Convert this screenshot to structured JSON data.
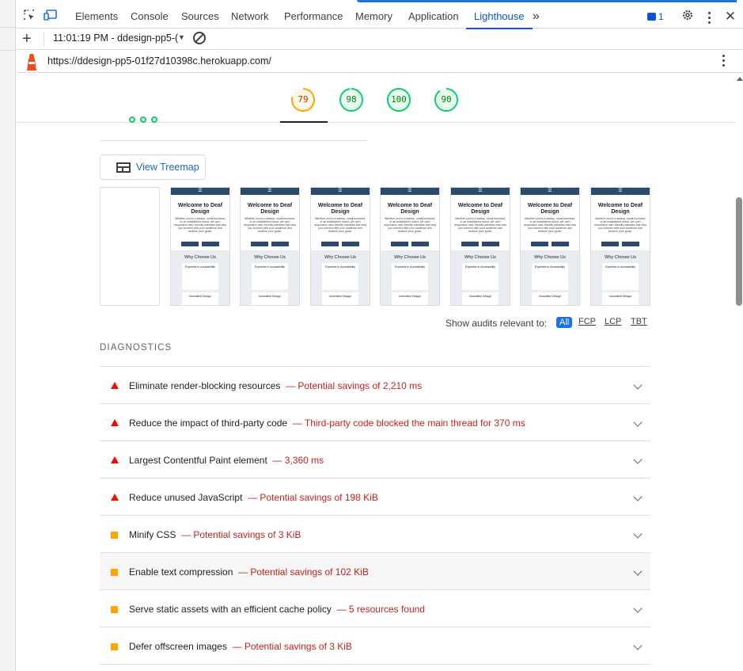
{
  "devtools": {
    "tabs": [
      "Elements",
      "Console",
      "Sources",
      "Network",
      "Performance",
      "Memory",
      "Application",
      "Lighthouse"
    ],
    "active_tab": "Lighthouse",
    "more_tabs": "»",
    "issues_count": "1"
  },
  "toolbar": {
    "add": "+",
    "report_label": "11:01:19 PM - ddesign-pp5-(",
    "caret": "▼"
  },
  "url": "https://ddesign-pp5-01f27d10398c.herokuapp.com/",
  "scores": [
    {
      "value": "79",
      "color": "#ffa400",
      "fill": 0.79
    },
    {
      "value": "98",
      "color": "#0cce6b",
      "fill": 0.98
    },
    {
      "value": "100",
      "color": "#0cce6b",
      "fill": 1.0
    },
    {
      "value": "90",
      "color": "#0cce6b",
      "fill": 0.9
    }
  ],
  "treemap_label": "View Treemap",
  "filmstrip": {
    "frame_title": "Welcome to Deaf Design",
    "frame_text": "Whether you're a startup, small business, or an established brand, we can't responsive user-friendly websites that help you connect with your audience and achieve your goals.",
    "frame_section": "Why Choose Us",
    "frame_card": "Expertise in Accessibility",
    "frame_card2": "Innovative Design"
  },
  "filters": {
    "label": "Show audits relevant to:",
    "chips": [
      "All",
      "FCP",
      "LCP",
      "TBT"
    ]
  },
  "diagnostics": {
    "title": "DIAGNOSTICS",
    "items": [
      {
        "severity": "fail",
        "title": "Eliminate render-blocking resources",
        "detail": "— Potential savings of 2,210 ms"
      },
      {
        "severity": "fail",
        "title": "Reduce the impact of third-party code",
        "detail": "— Third-party code blocked the main thread for 370 ms"
      },
      {
        "severity": "fail",
        "title": "Largest Contentful Paint element",
        "detail": "— 3,360 ms"
      },
      {
        "severity": "fail",
        "title": "Reduce unused JavaScript",
        "detail": "— Potential savings of 198 KiB"
      },
      {
        "severity": "average",
        "title": "Minify CSS",
        "detail": "— Potential savings of 3 KiB"
      },
      {
        "severity": "average",
        "title": "Enable text compression",
        "detail": "— Potential savings of 102 KiB"
      },
      {
        "severity": "average",
        "title": "Serve static assets with an efficient cache policy",
        "detail": "— 5 resources found"
      },
      {
        "severity": "average",
        "title": "Defer offscreen images",
        "detail": "— Potential savings of 3 KiB"
      }
    ]
  },
  "colors": {
    "fail": "#eb0f00",
    "average": "#ffa400",
    "pass": "#0cce6b",
    "accent": "#0b57d0"
  }
}
